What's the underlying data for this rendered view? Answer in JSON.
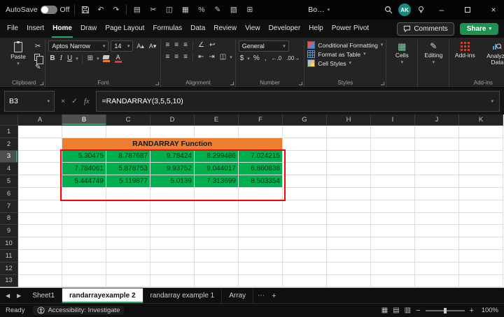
{
  "colors": {
    "header_orange": "#ED7D31",
    "cell_green": "#00B050",
    "annotation_red": "#FF0000",
    "share_green": "#1E9150",
    "avatar_teal": "#1A8A80",
    "accent_green": "#27A567"
  },
  "titlebar": {
    "autosave_label": "AutoSave",
    "autosave_state": "Off",
    "workbook_title": "Bo…",
    "avatar_initials": "AK",
    "qat_icons": [
      {
        "name": "clipboard",
        "glyph": "▤"
      },
      {
        "name": "cut",
        "glyph": "✂"
      },
      {
        "name": "paste",
        "glyph": "◫"
      },
      {
        "name": "chart",
        "glyph": "▦"
      },
      {
        "name": "percent-style",
        "glyph": "%"
      },
      {
        "name": "format-painter",
        "glyph": "✎"
      },
      {
        "name": "table",
        "glyph": "▧"
      },
      {
        "name": "borders",
        "glyph": "⊞"
      }
    ]
  },
  "menu": {
    "tabs": [
      "File",
      "Insert",
      "Home",
      "Draw",
      "Page Layout",
      "Formulas",
      "Data",
      "Review",
      "View",
      "Developer",
      "Help",
      "Power Pivot"
    ],
    "active_tab": "Home",
    "comments_label": "Comments",
    "share_label": "Share"
  },
  "ribbon": {
    "clipboard": {
      "paste_label": "Paste",
      "group_label": "Clipboard"
    },
    "font": {
      "name": "Aptos Narrow",
      "size": "14",
      "bold": "B",
      "italic": "I",
      "underline": "U",
      "group_label": "Font"
    },
    "alignment": {
      "group_label": "Alignment"
    },
    "number": {
      "format": "General",
      "currency": "$",
      "percent": "%",
      "comma": ",",
      "increase_decimal": "←.0",
      "decrease_decimal": ".00→",
      "group_label": "Number"
    },
    "styles": {
      "items": [
        "Conditional Formatting",
        "Format as Table",
        "Cell Styles"
      ],
      "group_label": "Styles"
    },
    "cells_label": "Cells",
    "editing_label": "Editing",
    "addins": {
      "addins_label": "Add-ins",
      "analyze_label": "Analyze Data",
      "group_label": "Add-ins"
    }
  },
  "formula_bar": {
    "name_box": "B3",
    "fx_label": "fx",
    "formula": "=RANDARRAY(3,5,5,10)"
  },
  "grid": {
    "columns": [
      "A",
      "B",
      "C",
      "D",
      "E",
      "F",
      "G",
      "H",
      "I",
      "J",
      "K"
    ],
    "rows": [
      "1",
      "2",
      "3",
      "4",
      "5",
      "6",
      "7",
      "8",
      "9",
      "10",
      "11",
      "12",
      "13"
    ],
    "selected_column": "B",
    "selected_row": "3",
    "title_cell": {
      "text": "RANDARRAY Function"
    },
    "data": [
      [
        "5.30475",
        "8.787687",
        "9.78424",
        "8.299486",
        "7.024215"
      ],
      [
        "7.784061",
        "5.878753",
        "9.93752",
        "9.044017",
        "6.860838"
      ],
      [
        "5.444749",
        "5.119877",
        "5.0139",
        "7.313699",
        "8.503354"
      ]
    ]
  },
  "sheet_tabs": {
    "tabs": [
      "Sheet1",
      "randarrayexample 2",
      "randarray example 1",
      "Array"
    ],
    "active": "randarrayexample 2"
  },
  "status_bar": {
    "ready_label": "Ready",
    "accessibility_label": "Accessibility: Investigate",
    "zoom_level": "100%"
  },
  "icons": {
    "chevron_down": "▾",
    "undo": "↶",
    "redo": "↷",
    "cancel": "×",
    "enter": "✓",
    "cut": "✂",
    "format_painter": "✎",
    "borders": "⊞",
    "grow_font": "A▴",
    "shrink_font": "A▾",
    "font_color_letter": "A",
    "align": "≡",
    "orientation": "∠",
    "wrap": "↩",
    "merge": "◫",
    "indent_left": "⇤",
    "indent_right": "⇥",
    "cells": "▦",
    "editing": "✎",
    "nav_left": "◀",
    "nav_right": "▶",
    "more": "⋯",
    "add_sheet": "+",
    "view_normal": "▦",
    "view_layout": "▤",
    "view_break": "▥",
    "zoom_out": "−",
    "zoom_in": "+"
  }
}
